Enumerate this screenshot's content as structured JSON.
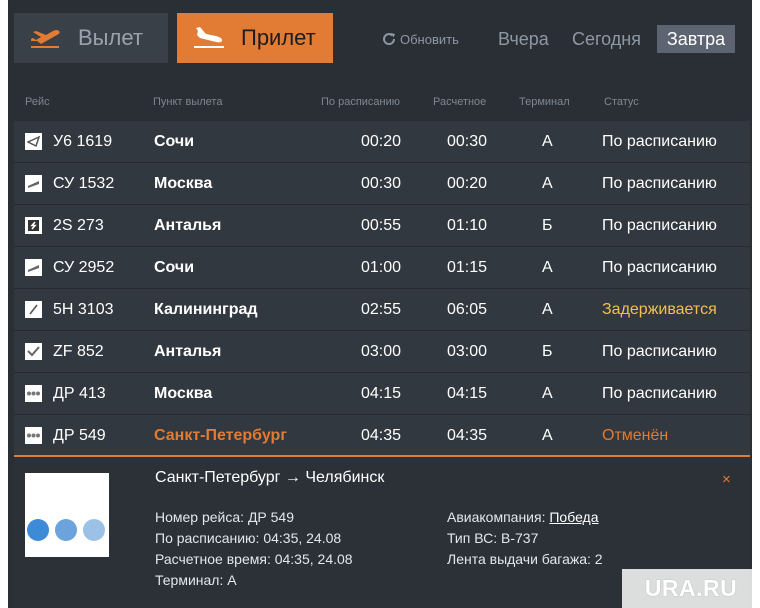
{
  "tabs": {
    "departure": "Вылет",
    "arrival": "Прилет"
  },
  "refresh_label": "Обновить",
  "days": {
    "yesterday": "Вчера",
    "today": "Сегодня",
    "tomorrow": "Завтра"
  },
  "columns": {
    "flight": "Рейс",
    "origin": "Пункт вылета",
    "scheduled": "По расписанию",
    "estimated": "Расчетное",
    "terminal": "Терминал",
    "status": "Статус"
  },
  "flights": [
    {
      "logo": "airline-u6-logo",
      "flight": "У6 1619",
      "origin": "Сочи",
      "scheduled": "00:20",
      "estimated": "00:30",
      "terminal": "А",
      "status": "По расписанию",
      "status_color": "#ffffff",
      "origin_color": "#ffffff"
    },
    {
      "logo": "airline-su-logo",
      "flight": "СУ 1532",
      "origin": "Москва",
      "scheduled": "00:30",
      "estimated": "00:20",
      "terminal": "А",
      "status": "По расписанию",
      "status_color": "#ffffff",
      "origin_color": "#ffffff"
    },
    {
      "logo": "airline-s7-logo",
      "flight": "2S 273",
      "origin": "Анталья",
      "scheduled": "00:55",
      "estimated": "01:10",
      "terminal": "Б",
      "status": "По расписанию",
      "status_color": "#ffffff",
      "origin_color": "#ffffff"
    },
    {
      "logo": "airline-su-logo",
      "flight": "СУ 2952",
      "origin": "Сочи",
      "scheduled": "01:00",
      "estimated": "01:15",
      "terminal": "А",
      "status": "По расписанию",
      "status_color": "#ffffff",
      "origin_color": "#ffffff"
    },
    {
      "logo": "airline-5n-logo",
      "flight": "5Н 3103",
      "origin": "Калининград",
      "scheduled": "02:55",
      "estimated": "06:05",
      "terminal": "А",
      "status": "Задерживается",
      "status_color": "#f0c24d",
      "origin_color": "#ffffff"
    },
    {
      "logo": "airline-zf-logo",
      "flight": "ZF 852",
      "origin": "Анталья",
      "scheduled": "03:00",
      "estimated": "03:00",
      "terminal": "Б",
      "status": "По расписанию",
      "status_color": "#ffffff",
      "origin_color": "#ffffff"
    },
    {
      "logo": "airline-dp-logo",
      "flight": "ДР 413",
      "origin": "Москва",
      "scheduled": "04:15",
      "estimated": "04:15",
      "terminal": "А",
      "status": "По расписанию",
      "status_color": "#ffffff",
      "origin_color": "#ffffff"
    },
    {
      "logo": "airline-dp-logo",
      "flight": "ДР 549",
      "origin": "Санкт-Петербург",
      "scheduled": "04:35",
      "estimated": "04:35",
      "terminal": "А",
      "status": "Отменён",
      "status_color": "#e27b33",
      "origin_color": "#e27b33"
    }
  ],
  "detail": {
    "route": "Санкт-Петербург → Челябинск",
    "close": "×",
    "flight_number": "Номер рейса: ДР 549",
    "scheduled": "По расписанию: 04:35, 24.08",
    "estimated": "Расчетное время: 04:35, 24.08",
    "terminal": "Терминал: А",
    "airline_label": "Авиакомпания:",
    "airline_name": "Победа",
    "aircraft": "Тип ВС: B-737",
    "baggage": "Лента выдачи багажа: 2"
  },
  "watermark": "URA.RU",
  "colors": {
    "accent": "#e27b33",
    "delayed": "#f0c24d",
    "background": "#2a2f36",
    "row": "#32383f"
  }
}
